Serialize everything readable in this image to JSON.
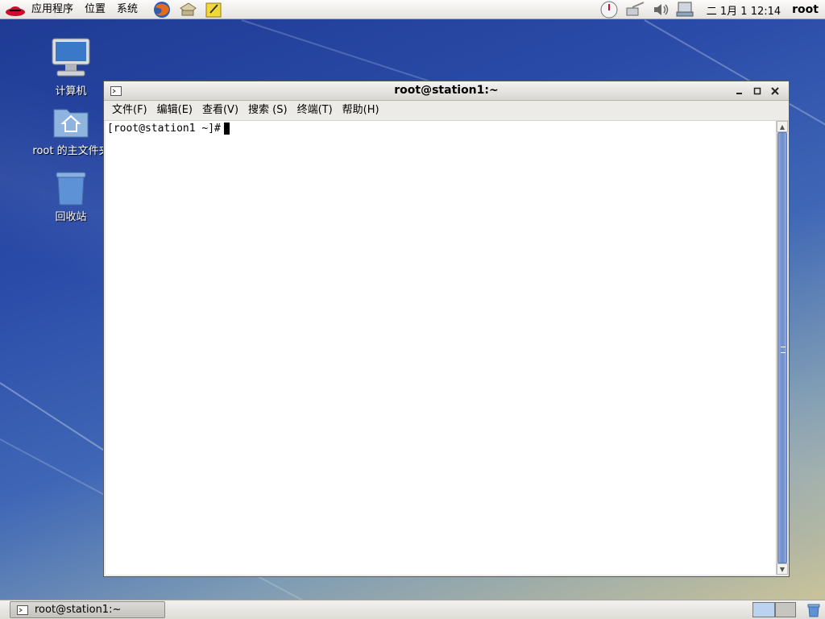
{
  "top_panel": {
    "menus": [
      "应用程序",
      "位置",
      "系统"
    ],
    "launchers": [
      "firefox-icon",
      "mail-icon",
      "notes-icon"
    ],
    "tray_icons": [
      "update-icon",
      "network-icon",
      "volume-icon",
      "display-icon"
    ],
    "clock": "二  1月  1 12:14",
    "user": "root"
  },
  "desktop": {
    "icons": [
      {
        "name": "computer-icon",
        "label": "计算机"
      },
      {
        "name": "home-folder-icon",
        "label": "root 的主文件夹"
      },
      {
        "name": "trash-icon",
        "label": "回收站"
      }
    ]
  },
  "window": {
    "title": "root@station1:~",
    "menu": [
      "文件(F)",
      "编辑(E)",
      "查看(V)",
      "搜索 (S)",
      "终端(T)",
      "帮助(H)"
    ],
    "prompt": "[root@station1 ~]#"
  },
  "bottom_panel": {
    "task": "root@station1:~"
  },
  "colors": {
    "desktop_top": "#1f3b94",
    "scroll_thumb": "#6d8cc9",
    "terminal_bg": "#ffffff"
  }
}
